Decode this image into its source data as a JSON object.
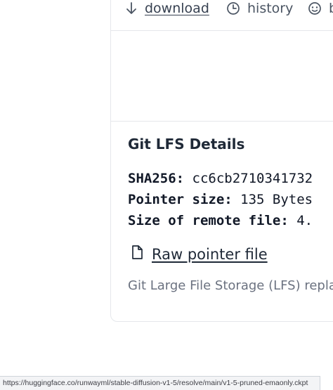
{
  "toolbar": {
    "download_label": "download",
    "history_label": "history",
    "blame_label": "b"
  },
  "lfs": {
    "title": "Git LFS Details",
    "sha_key": "SHA256:",
    "sha_value": "cc6cb2710341732",
    "pointer_size_key": "Pointer size:",
    "pointer_size_value": "135 Bytes",
    "remote_size_key": "Size of remote file:",
    "remote_size_value": "4.",
    "raw_pointer_label": "Raw pointer file",
    "description": "Git Large File Storage (LFS) replac"
  },
  "status_bar": {
    "url": "https://huggingface.co/runwayml/stable-diffusion-v1-5/resolve/main/v1-5-pruned-emaonly.ckpt"
  },
  "icons": {
    "download": "download-arrow-icon",
    "history": "clock-icon",
    "blame": "smiley-icon",
    "raw_pointer": "file-icon"
  }
}
